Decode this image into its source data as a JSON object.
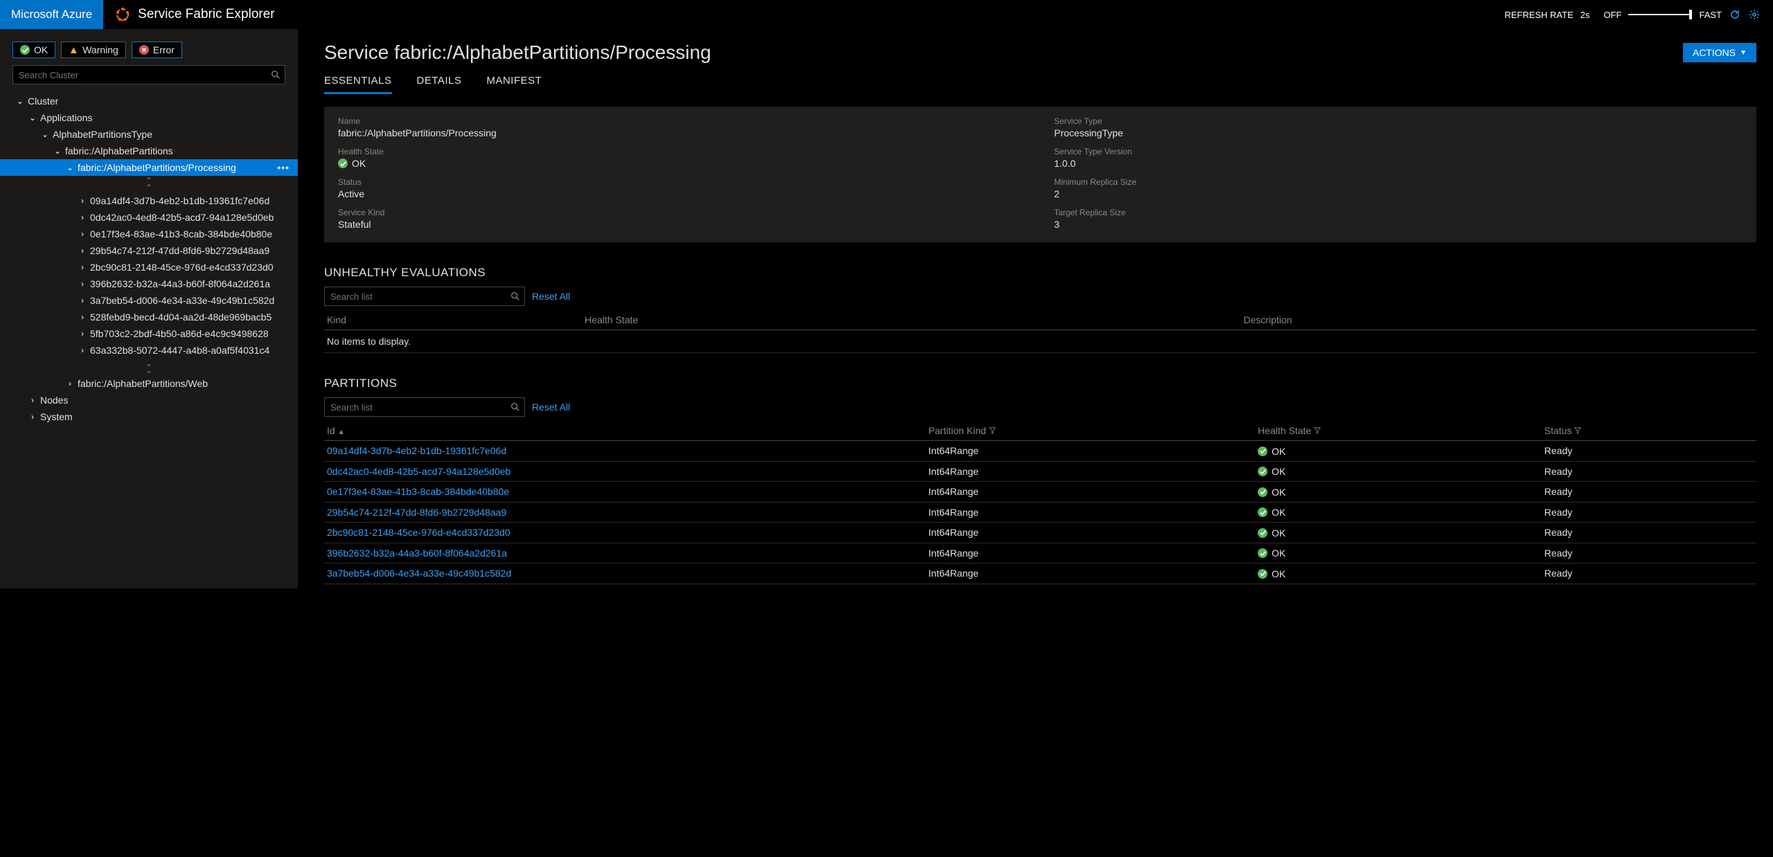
{
  "topbar": {
    "brand": "Microsoft Azure",
    "product": "Service Fabric Explorer",
    "refresh_label": "REFRESH RATE",
    "refresh_value": "2s",
    "off_label": "OFF",
    "fast_label": "FAST"
  },
  "filters": {
    "ok": "OK",
    "warning": "Warning",
    "error": "Error"
  },
  "search": {
    "cluster_placeholder": "Search Cluster",
    "list_placeholder": "Search list",
    "reset": "Reset All"
  },
  "tree": {
    "cluster": "Cluster",
    "applications": "Applications",
    "app_type": "AlphabetPartitionsType",
    "app": "fabric:/AlphabetPartitions",
    "service_processing": "fabric:/AlphabetPartitions/Processing",
    "service_web": "fabric:/AlphabetPartitions/Web",
    "partitions": [
      "09a14df4-3d7b-4eb2-b1db-19361fc7e06d",
      "0dc42ac0-4ed8-42b5-acd7-94a128e5d0eb",
      "0e17f3e4-83ae-41b3-8cab-384bde40b80e",
      "29b54c74-212f-47dd-8fd6-9b2729d48aa9",
      "2bc90c81-2148-45ce-976d-e4cd337d23d0",
      "396b2632-b32a-44a3-b60f-8f064a2d261a",
      "3a7beb54-d006-4e34-a33e-49c49b1c582d",
      "528febd9-becd-4d04-aa2d-48de969bacb5",
      "5fb703c2-2bdf-4b50-a86d-e4c9c9498628",
      "63a332b8-5072-4447-a4b8-a0af5f4031c4"
    ],
    "nodes": "Nodes",
    "system": "System"
  },
  "page": {
    "title_prefix": "Service",
    "title_path": "fabric:/AlphabetPartitions/Processing",
    "actions": "ACTIONS",
    "tabs": {
      "essentials": "ESSENTIALS",
      "details": "DETAILS",
      "manifest": "MANIFEST"
    }
  },
  "essentials": {
    "name_k": "Name",
    "name_v": "fabric:/AlphabetPartitions/Processing",
    "type_k": "Service Type",
    "type_v": "ProcessingType",
    "health_k": "Health State",
    "health_v": "OK",
    "typever_k": "Service Type Version",
    "typever_v": "1.0.0",
    "status_k": "Status",
    "status_v": "Active",
    "minrep_k": "Minimum Replica Size",
    "minrep_v": "2",
    "kind_k": "Service Kind",
    "kind_v": "Stateful",
    "tgtrep_k": "Target Replica Size",
    "tgtrep_v": "3"
  },
  "sections": {
    "unhealthy": "UNHEALTHY EVALUATIONS",
    "partitions": "PARTITIONS",
    "no_items": "No items to display."
  },
  "unhealthy_cols": {
    "kind": "Kind",
    "health": "Health State",
    "desc": "Description"
  },
  "part_cols": {
    "id": "Id",
    "kind": "Partition Kind",
    "health": "Health State",
    "status": "Status"
  },
  "partitions_table": [
    {
      "id": "09a14df4-3d7b-4eb2-b1db-19361fc7e06d",
      "kind": "Int64Range",
      "health": "OK",
      "status": "Ready"
    },
    {
      "id": "0dc42ac0-4ed8-42b5-acd7-94a128e5d0eb",
      "kind": "Int64Range",
      "health": "OK",
      "status": "Ready"
    },
    {
      "id": "0e17f3e4-83ae-41b3-8cab-384bde40b80e",
      "kind": "Int64Range",
      "health": "OK",
      "status": "Ready"
    },
    {
      "id": "29b54c74-212f-47dd-8fd6-9b2729d48aa9",
      "kind": "Int64Range",
      "health": "OK",
      "status": "Ready"
    },
    {
      "id": "2bc90c81-2148-45ce-976d-e4cd337d23d0",
      "kind": "Int64Range",
      "health": "OK",
      "status": "Ready"
    },
    {
      "id": "396b2632-b32a-44a3-b60f-8f064a2d261a",
      "kind": "Int64Range",
      "health": "OK",
      "status": "Ready"
    },
    {
      "id": "3a7beb54-d006-4e34-a33e-49c49b1c582d",
      "kind": "Int64Range",
      "health": "OK",
      "status": "Ready"
    }
  ]
}
